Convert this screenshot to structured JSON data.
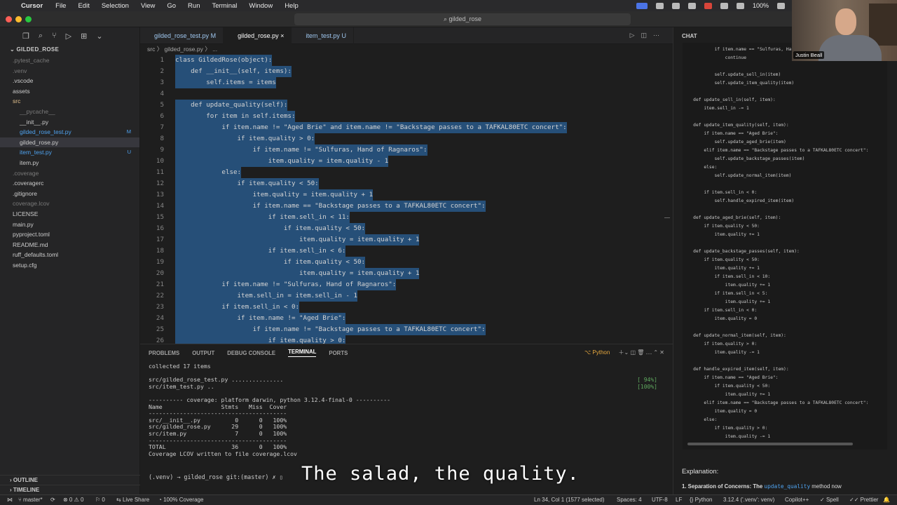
{
  "menubar": {
    "app": "Cursor",
    "items": [
      "File",
      "Edit",
      "Selection",
      "View",
      "Go",
      "Run",
      "Terminal",
      "Window",
      "Help"
    ],
    "battery": "100%"
  },
  "titlebar": {
    "search": "gilded_rose"
  },
  "sidebar": {
    "project": "GILDED_ROSE",
    "items": [
      {
        "label": ".pytest_cache",
        "indent": 1,
        "dim": true
      },
      {
        "label": ".venv",
        "indent": 1,
        "dim": true
      },
      {
        "label": ".vscode",
        "indent": 1
      },
      {
        "label": "assets",
        "indent": 1
      },
      {
        "label": "src",
        "indent": 1,
        "color": "#e2c08d"
      },
      {
        "label": "__pycache__",
        "indent": 2,
        "dim": true
      },
      {
        "label": "__init__.py",
        "indent": 2
      },
      {
        "label": "gilded_rose_test.py",
        "indent": 2,
        "color": "#4fa3f0",
        "badge": "M"
      },
      {
        "label": "gilded_rose.py",
        "indent": 2,
        "selected": true
      },
      {
        "label": "item_test.py",
        "indent": 2,
        "color": "#4fa3f0",
        "badge": "U"
      },
      {
        "label": "item.py",
        "indent": 2
      },
      {
        "label": ".coverage",
        "indent": 1,
        "dim": true
      },
      {
        "label": ".coveragerc",
        "indent": 1
      },
      {
        "label": ".gitignore",
        "indent": 1
      },
      {
        "label": "coverage.lcov",
        "indent": 1,
        "dim": true
      },
      {
        "label": "LICENSE",
        "indent": 1
      },
      {
        "label": "main.py",
        "indent": 1
      },
      {
        "label": "pyproject.toml",
        "indent": 1
      },
      {
        "label": "README.md",
        "indent": 1
      },
      {
        "label": "ruff_defaults.toml",
        "indent": 1
      },
      {
        "label": "setup.cfg",
        "indent": 1
      }
    ],
    "outline": "OUTLINE",
    "timeline": "TIMELINE"
  },
  "tabs": [
    {
      "label": "gilded_rose_test.py",
      "suffix": "M",
      "active": false
    },
    {
      "label": "gilded_rose.py",
      "suffix": "×",
      "active": true
    },
    {
      "label": "item_test.py",
      "suffix": "U",
      "active": false
    }
  ],
  "breadcrumb": "src 〉 gilded_rose.py 〉 ...",
  "code": [
    {
      "n": "1",
      "t": "class GildedRose(object):"
    },
    {
      "n": "2",
      "t": "    def __init__(self, items):"
    },
    {
      "n": "3",
      "t": "        self.items = items"
    },
    {
      "n": "4",
      "t": ""
    },
    {
      "n": "5",
      "t": "    def update_quality(self):"
    },
    {
      "n": "6",
      "t": "        for item in self.items:"
    },
    {
      "n": "7",
      "t": "            if item.name != \"Aged Brie\" and item.name != \"Backstage passes to a TAFKAL80ETC concert\":"
    },
    {
      "n": "8",
      "t": "                if item.quality > 0:"
    },
    {
      "n": "9",
      "t": "                    if item.name != \"Sulfuras, Hand of Ragnaros\":"
    },
    {
      "n": "10",
      "t": "                        item.quality = item.quality - 1"
    },
    {
      "n": "11",
      "t": "            else:"
    },
    {
      "n": "12",
      "t": "                if item.quality < 50:"
    },
    {
      "n": "13",
      "t": "                    item.quality = item.quality + 1"
    },
    {
      "n": "14",
      "t": "                    if item.name == \"Backstage passes to a TAFKAL80ETC concert\":"
    },
    {
      "n": "15",
      "t": "                        if item.sell_in < 11:"
    },
    {
      "n": "16",
      "t": "                            if item.quality < 50:"
    },
    {
      "n": "17",
      "t": "                                item.quality = item.quality + 1"
    },
    {
      "n": "18",
      "t": "                        if item.sell_in < 6:"
    },
    {
      "n": "19",
      "t": "                            if item.quality < 50:"
    },
    {
      "n": "20",
      "t": "                                item.quality = item.quality + 1"
    },
    {
      "n": "21",
      "t": "            if item.name != \"Sulfuras, Hand of Ragnaros\":"
    },
    {
      "n": "22",
      "t": "                item.sell_in = item.sell_in - 1"
    },
    {
      "n": "23",
      "t": "            if item.sell_in < 0:"
    },
    {
      "n": "24",
      "t": "                if item.name != \"Aged Brie\":"
    },
    {
      "n": "25",
      "t": "                    if item.name != \"Backstage passes to a TAFKAL80ETC concert\":"
    },
    {
      "n": "26",
      "t": "                        if item.quality > 0:"
    }
  ],
  "panel": {
    "tabs": [
      "PROBLEMS",
      "OUTPUT",
      "DEBUG CONSOLE",
      "TERMINAL",
      "PORTS"
    ],
    "active_tab": "TERMINAL",
    "shell_label": "Python",
    "terminal_lines": [
      "collected 17 items",
      "",
      "src/gilded_rose_test.py ...............",
      "src/item_test.py ..",
      "",
      "---------- coverage: platform darwin, python 3.12.4-final-0 ----------",
      "Name                 Stmts   Miss  Cover",
      "----------------------------------------",
      "src/__init__.py          0      0   100%",
      "src/gilded_rose.py      29      0   100%",
      "src/item.py              7      0   100%",
      "----------------------------------------",
      "TOTAL                   36      0   100%",
      "Coverage LCOV written to file coverage.lcov"
    ],
    "progress": [
      "[ 94%]",
      "[100%]"
    ],
    "prompt": "(.venv) → gilded_rose git:(master) ✗ ▯"
  },
  "chat": {
    "title": "CHAT",
    "code_lines": [
      "            if item.name == \"Sulfuras, Hand of Ragnaros\":",
      "                continue",
      "",
      "            self.update_sell_in(item)",
      "            self.update_item_quality(item)",
      "",
      "    def update_sell_in(self, item):",
      "        item.sell_in -= 1",
      "",
      "    def update_item_quality(self, item):",
      "        if item.name == \"Aged Brie\":",
      "            self.update_aged_brie(item)",
      "        elif item.name == \"Backstage passes to a TAFKAL80ETC concert\":",
      "            self.update_backstage_passes(item)",
      "        else:",
      "            self.update_normal_item(item)",
      "",
      "        if item.sell_in < 0:",
      "            self.handle_expired_item(item)",
      "",
      "    def update_aged_brie(self, item):",
      "        if item.quality < 50:",
      "            item.quality += 1",
      "",
      "    def update_backstage_passes(self, item):",
      "        if item.quality < 50:",
      "            item.quality += 1",
      "            if item.sell_in < 10:",
      "                item.quality += 1",
      "            if item.sell_in < 5:",
      "                item.quality += 1",
      "        if item.sell_in < 0:",
      "            item.quality = 0",
      "",
      "    def update_normal_item(self, item):",
      "        if item.quality > 0:",
      "            item.quality -= 1",
      "",
      "    def handle_expired_item(self, item):",
      "        if item.name == \"Aged Brie\":",
      "            if item.quality < 50:",
      "                item.quality += 1",
      "        elif item.name == \"Backstage passes to a TAFKAL80ETC concert\":",
      "            item.quality = 0",
      "        else:",
      "            if item.quality > 0:",
      "                item.quality -= 1"
    ],
    "explanation_title": "Explanation:",
    "point_prefix": "1. Separation of Concerns: The ",
    "point_method": "update_quality",
    "point_suffix": " method now"
  },
  "webcam": {
    "name": "Justin Beall"
  },
  "caption": "The salad, the quality.",
  "statusbar": {
    "branch": "master*",
    "problems": "⊗ 0 ⚠ 0",
    "ports": "⚐ 0",
    "live_share": "Live Share",
    "coverage": "100% Coverage",
    "position": "Ln 34, Col 1 (1577 selected)",
    "spaces": "Spaces: 4",
    "encoding": "UTF-8",
    "eol": "LF",
    "language": "Python",
    "interpreter": "3.12.4 ('.venv': venv)",
    "copilot": "Copilot++",
    "spell": "Spell",
    "prettier": "Prettier"
  }
}
